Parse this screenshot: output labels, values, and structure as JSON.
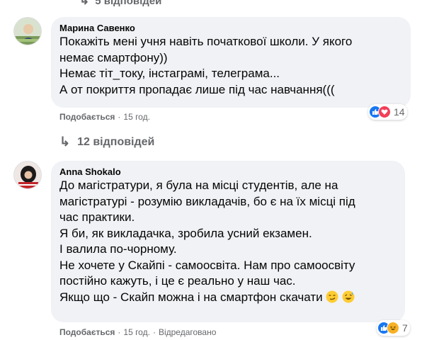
{
  "top_partial": {
    "replies_label": "5 відповідей"
  },
  "comments": [
    {
      "author": "Марина Савенко",
      "lines": [
        "Покажіть мені учня навіть початкової школи. У якого",
        "немає смартфону))",
        "Немає тіт_току, інстаграмі, телеграма...",
        "А от покриття пропадає лише під час навчання((("
      ],
      "actions": {
        "like": "Подобається",
        "sep": "·",
        "time": "15 год."
      },
      "reactions": {
        "icons": [
          "like-icon",
          "love-icon"
        ],
        "count": "14"
      },
      "replies": "12 відповідей"
    },
    {
      "author": "Anna Shokalo",
      "lines": [
        "До магістратури, я була на місці студентів, але на",
        "магістратурі - розумію викладачів, бо є на їх місці під",
        "час практики.",
        "Я би, як викладачка, зробила усний екзамен.",
        "І валила по-чорному.",
        "Не хочете у Скайпі - самоосвіта. Нам про самоосвіту",
        "постійно кажуть, і це є реально у наш час.",
        "Якщо що - Скайп можна і на смартфон скачати"
      ],
      "emojis": [
        "smirk-emoji",
        "sweat-smile-emoji"
      ],
      "actions": {
        "like": "Подобається",
        "sep": "·",
        "time": "15 год.",
        "sep2": "·",
        "edited": "Відредаговано"
      },
      "reactions": {
        "icons": [
          "like-icon",
          "haha-icon"
        ],
        "count": "7"
      }
    }
  ],
  "colors": {
    "bubble": "#f0f2f5",
    "secondary_text": "#65676b",
    "like_blue": "#1877f2",
    "love_red": "#f33e58",
    "haha_yellow": "#f7b125"
  }
}
